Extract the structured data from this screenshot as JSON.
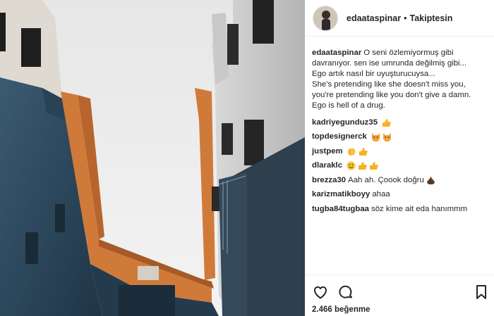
{
  "post": {
    "username": "edaataspinar",
    "separator": "•",
    "follow_status": "Takiptesin"
  },
  "caption": {
    "username": "edaataspinar",
    "lines": [
      "O seni özlemiyormuş gibi",
      "davranıyor. sen ise umrunda değilmiş gibi...",
      "Ego artık nasıl bir uyuşturucuysa...",
      "She's pretending like she doesn't miss you,",
      "you're pretending like you don't give a damn.",
      "Ego is hell of a drug."
    ]
  },
  "comments": [
    {
      "username": "kadriyegunduz35",
      "text": "",
      "emojis": [
        "thumbs-up"
      ]
    },
    {
      "username": "topdesignerck",
      "text": "",
      "emojis": [
        "cat-face",
        "cat-face"
      ]
    },
    {
      "username": "justpem",
      "text": "",
      "emojis": [
        "clapping-hands",
        "thumbs-up"
      ]
    },
    {
      "username": "dlaraklc",
      "text": "",
      "emojis": [
        "smiley",
        "thumbs-up",
        "thumbs-up"
      ]
    },
    {
      "username": "brezza30",
      "text": "Aah ah. Çoook doğru",
      "emojis": [
        "poop"
      ]
    },
    {
      "username": "karizmatikboyy",
      "text": "ahaa",
      "emojis": []
    },
    {
      "username": "tugba84tugbaa",
      "text": "söz kime ait eda hanımmm",
      "emojis": []
    }
  ],
  "actions": {
    "like_icon": "heart-icon",
    "comment_icon": "comment-bubble-icon",
    "save_icon": "bookmark-icon",
    "likes_text": "2.466 beğenme"
  },
  "colors": {
    "sky": "#eeeeee",
    "wall_dark": "#2f4d63",
    "wall_orange": "#d07a3a",
    "thumb_yellow": "#f5b324"
  }
}
